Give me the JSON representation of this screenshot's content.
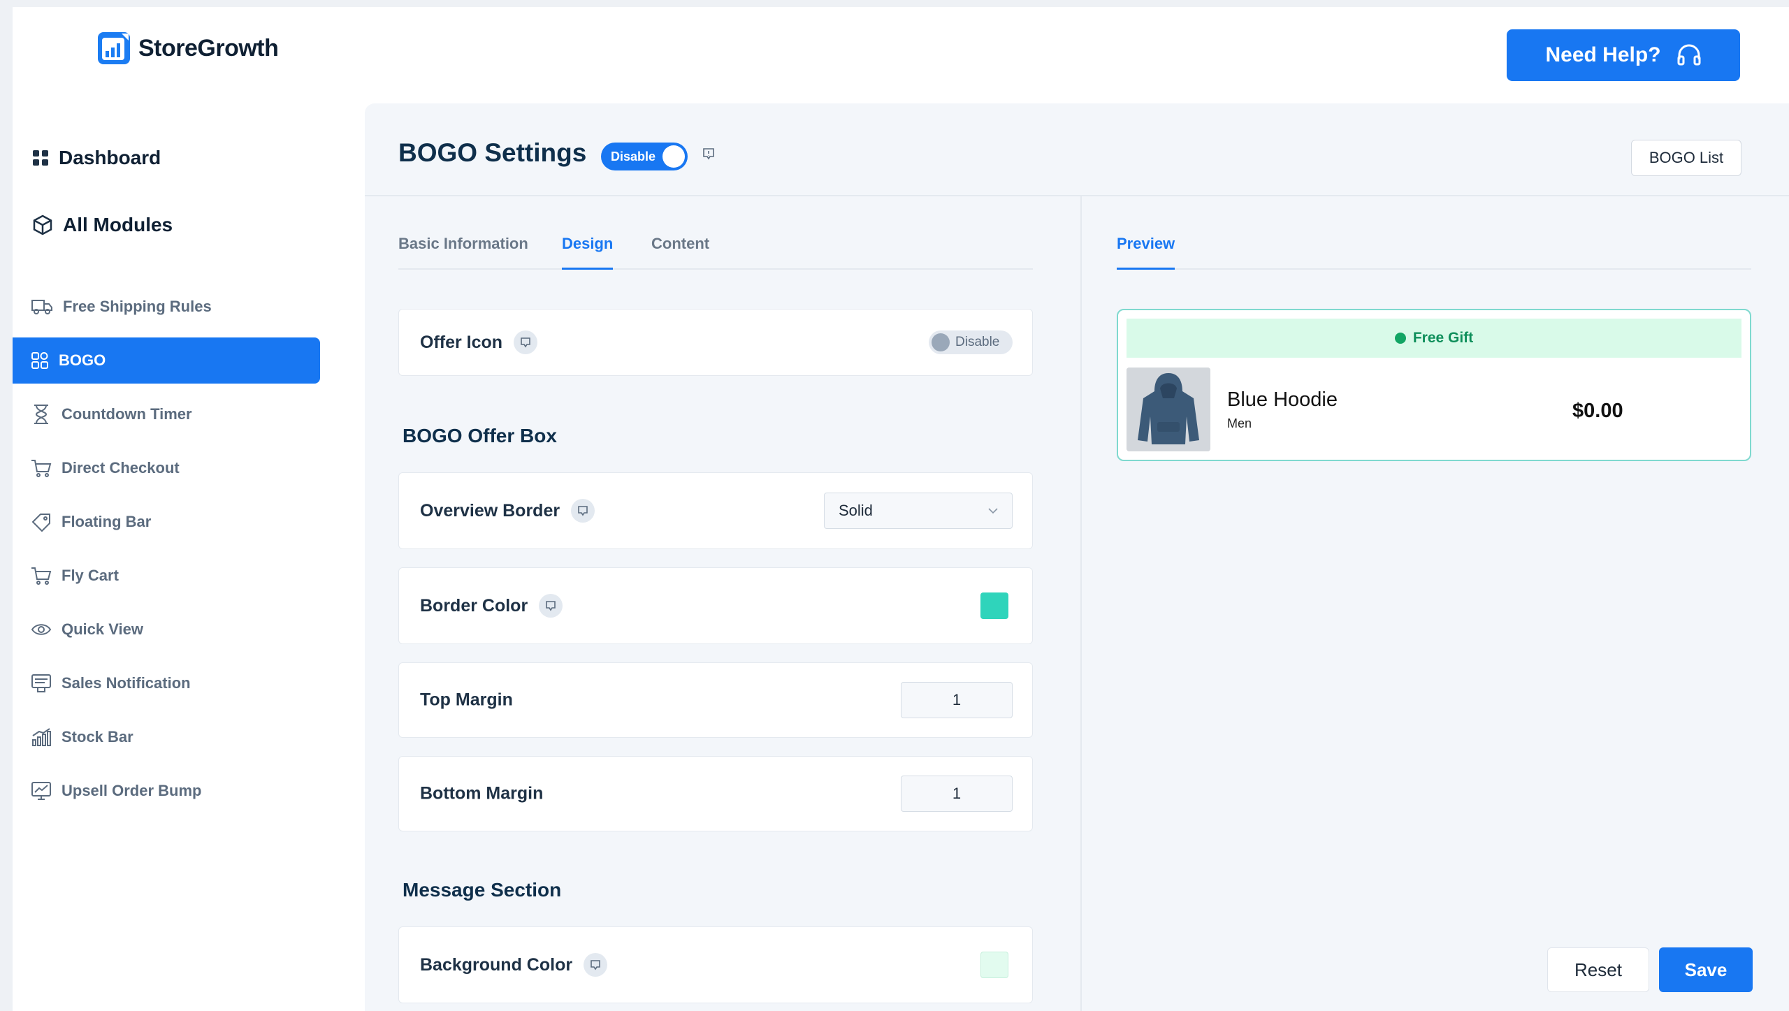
{
  "brand": {
    "name": "StoreGrowth",
    "accent": "#1877f2"
  },
  "header": {
    "help_label": "Need Help?"
  },
  "sidebar": {
    "top": [
      {
        "label": "Dashboard",
        "icon": "grid-icon"
      },
      {
        "label": "All Modules",
        "icon": "cube-icon"
      }
    ],
    "items": [
      {
        "label": "Free Shipping Rules",
        "icon": "truck-icon"
      },
      {
        "label": "BOGO",
        "icon": "apps-icon",
        "active": true
      },
      {
        "label": "Countdown Timer",
        "icon": "hourglass-icon"
      },
      {
        "label": "Direct Checkout",
        "icon": "cart-icon"
      },
      {
        "label": "Floating Bar",
        "icon": "tag-icon"
      },
      {
        "label": "Fly Cart",
        "icon": "cart-icon"
      },
      {
        "label": "Quick View",
        "icon": "eye-icon"
      },
      {
        "label": "Sales Notification",
        "icon": "notification-icon"
      },
      {
        "label": "Stock Bar",
        "icon": "bar-chart-icon"
      },
      {
        "label": "Upsell Order Bump",
        "icon": "monitor-chart-icon"
      }
    ]
  },
  "page": {
    "title": "BOGO Settings",
    "status_toggle": "Disable",
    "bogo_list_label": "BOGO List"
  },
  "tabs": [
    {
      "label": "Basic Information"
    },
    {
      "label": "Design",
      "active": true
    },
    {
      "label": "Content"
    }
  ],
  "design": {
    "offer_icon": {
      "label": "Offer Icon",
      "toggle": "Disable"
    },
    "offer_box_title": "BOGO Offer Box",
    "overview_border": {
      "label": "Overview Border",
      "value": "Solid"
    },
    "border_color": {
      "label": "Border Color",
      "color": "#2fd4bb"
    },
    "top_margin": {
      "label": "Top Margin",
      "value": "1"
    },
    "bottom_margin": {
      "label": "Bottom Margin",
      "value": "1"
    },
    "message_title": "Message Section",
    "background_color": {
      "label": "Background Color",
      "color": "#e2fbef"
    }
  },
  "preview": {
    "tab_label": "Preview",
    "gift_label": "Free Gift",
    "product_name": "Blue Hoodie",
    "product_category": "Men",
    "product_price": "$0.00"
  },
  "actions": {
    "reset_label": "Reset",
    "save_label": "Save"
  }
}
